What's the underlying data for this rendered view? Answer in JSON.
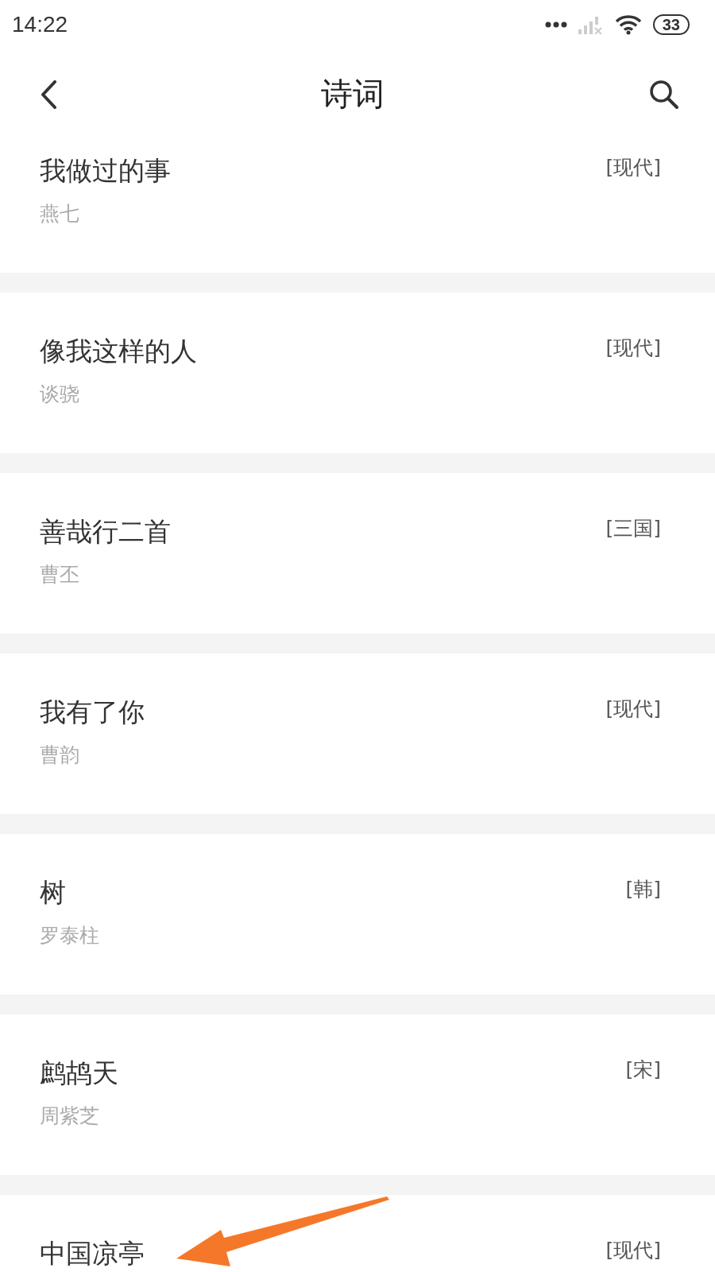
{
  "status_bar": {
    "time": "14:22",
    "battery": "33"
  },
  "header": {
    "title": "诗词"
  },
  "poems": [
    {
      "title": "我做过的事",
      "author": "燕七",
      "era": "[现代]"
    },
    {
      "title": "像我这样的人",
      "author": "谈骁",
      "era": "[现代]"
    },
    {
      "title": "善哉行二首",
      "author": "曹丕",
      "era": "[三国]"
    },
    {
      "title": "我有了你",
      "author": "曹韵",
      "era": "[现代]"
    },
    {
      "title": "树",
      "author": "罗泰柱",
      "era": "[韩]"
    },
    {
      "title": "鹧鸪天",
      "author": "周紫芝",
      "era": "[宋]"
    },
    {
      "title": "中国凉亭",
      "era": "[现代]"
    }
  ]
}
